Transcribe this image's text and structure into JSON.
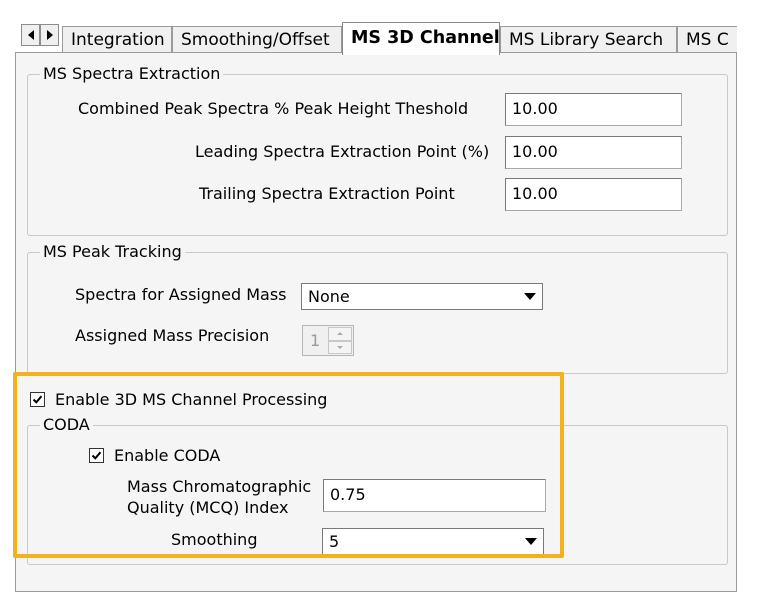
{
  "tabs": {
    "items": [
      "Integration",
      "Smoothing/Offset",
      "MS 3D Channel",
      "MS Library Search",
      "MS C"
    ],
    "active_index": 2
  },
  "spectra_extraction": {
    "legend": "MS Spectra Extraction",
    "combined_label": "Combined Peak Spectra % Peak Height Theshold",
    "combined_value": "10.00",
    "leading_label": "Leading Spectra Extraction Point (%)",
    "leading_value": "10.00",
    "trailing_label": "Trailing Spectra Extraction Point",
    "trailing_value": "10.00"
  },
  "peak_tracking": {
    "legend": "MS Peak Tracking",
    "spectra_label": "Spectra for Assigned Mass",
    "spectra_value": "None",
    "precision_label": "Assigned Mass Precision",
    "precision_value": "1"
  },
  "channel_processing": {
    "enable_label": "Enable 3D MS Channel Processing",
    "enable_checked": true,
    "coda": {
      "legend": "CODA",
      "enable_label": "Enable CODA",
      "enable_checked": true,
      "mcq_label_line1": "Mass Chromatographic",
      "mcq_label_line2": "Quality (MCQ) Index",
      "mcq_value": "0.75",
      "smoothing_label": "Smoothing",
      "smoothing_value": "5"
    }
  },
  "colors": {
    "highlight": "#f2b21d",
    "panel_bg": "#f5f5f5"
  }
}
